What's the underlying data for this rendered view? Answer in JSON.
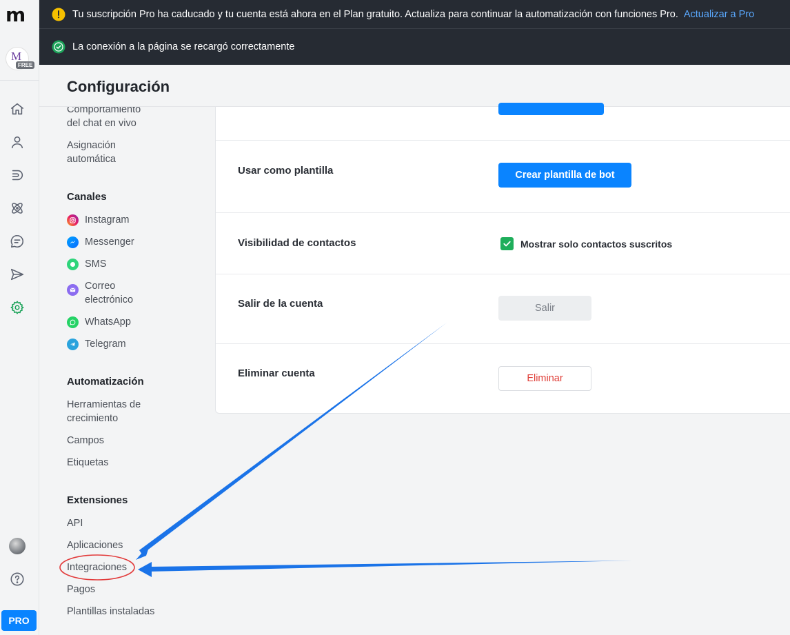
{
  "brand": {
    "logo_text": "m",
    "account_initial": "M",
    "account_badge": "FREE"
  },
  "banners": {
    "expired": {
      "text": "Tu suscripción Pro ha caducado y tu cuenta está ahora en el Plan gratuito. Actualiza para continuar la automatización con funciones Pro.",
      "link": "Actualizar a Pro"
    },
    "reloaded": {
      "text": "La conexión a la página se recargó correctamente"
    }
  },
  "header": {
    "title": "Configuración"
  },
  "nav": {
    "top_items": [
      "Comportamiento del chat en vivo",
      "Asignación automática"
    ],
    "channels_title": "Canales",
    "channels": [
      "Instagram",
      "Messenger",
      "SMS",
      "Correo electrónico",
      "WhatsApp",
      "Telegram"
    ],
    "automation_title": "Automatización",
    "automation": [
      "Herramientas de crecimiento",
      "Campos",
      "Etiquetas"
    ],
    "extensions_title": "Extensiones",
    "extensions": [
      "API",
      "Aplicaciones",
      "Integraciones",
      "Pagos",
      "Plantillas instaladas"
    ]
  },
  "settings": {
    "template": {
      "label": "Usar como plantilla",
      "button": "Crear plantilla de bot"
    },
    "visibility": {
      "label": "Visibilidad de contactos",
      "checkbox": "Mostrar solo contactos suscritos",
      "checked": true
    },
    "logout": {
      "label": "Salir de la cuenta",
      "button": "Salir"
    },
    "delete": {
      "label": "Eliminar cuenta",
      "button": "Eliminar"
    }
  },
  "footer": {
    "pro_button": "PRO"
  },
  "colors": {
    "accent_blue": "#0a84ff",
    "active_green": "#1da35a",
    "danger_red": "#e0403a",
    "annotation_blue": "#1a73e8",
    "annotation_red": "#e23b3b"
  },
  "icons": [
    "home-icon",
    "contacts-icon",
    "automation-icon",
    "atom-icon",
    "chat-icon",
    "send-icon",
    "settings-icon",
    "help-icon",
    "warning-icon",
    "check-circle-icon"
  ]
}
